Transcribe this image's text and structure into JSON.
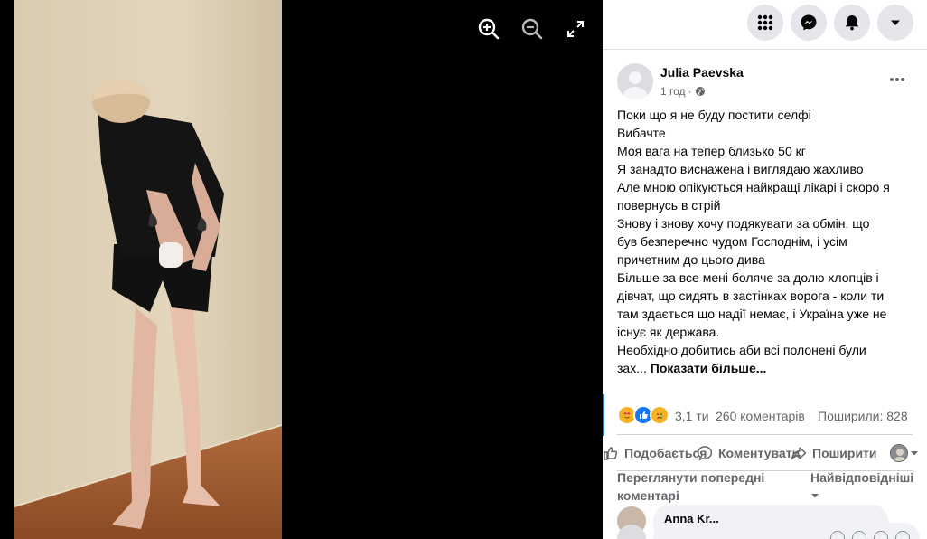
{
  "viewer": {
    "zoom_in_icon": "zoom-in-icon",
    "zoom_out_icon": "zoom-out-icon",
    "fullscreen_icon": "expand-icon"
  },
  "topnav": {
    "icons": [
      "apps-grid-icon",
      "messenger-icon",
      "bell-icon",
      "caret-down-icon"
    ]
  },
  "post": {
    "author": "Julia Paevska",
    "time": "1 год",
    "separator": "·",
    "privacy_icon": "globe-icon",
    "lines": [
      "Поки що я не буду постити селфі",
      "Вибачте",
      "Моя вага на тепер близько 50 кг",
      "Я занадто виснажена і виглядаю жахливо",
      "Але мною опікуються найкращі лікарі і скоро я",
      "повернусь в стрій",
      "Знову і знову хочу подякувати за обмін, що",
      "був безперечно чудом Господнім, і усім",
      "причетним до цього дива",
      "Більше за все мені боляче за долю хлопців і",
      "дівчат, що сидять в застінках ворога - коли ти",
      "там здається що надії немає, і Україна уже не",
      "існує як держава.",
      "Необхідно добитись аби всі полонені були"
    ],
    "last_line_prefix": "зах...",
    "see_more": "Показати більше..."
  },
  "stats": {
    "reactions": "3,1 ти",
    "comments": "260 коментарів",
    "shares": "Поширили: 828"
  },
  "actions": {
    "like": "Подобається",
    "comment": "Коментувати",
    "share": "Поширити"
  },
  "comments": {
    "view_previous": "Переглянути попередні коментарі",
    "sort": "Найвідповідніші",
    "first_author": "Anna Kr..."
  },
  "colors": {
    "accent": "#1877f2",
    "panel_bg": "#ffffff",
    "secondary_text": "#65676b"
  }
}
